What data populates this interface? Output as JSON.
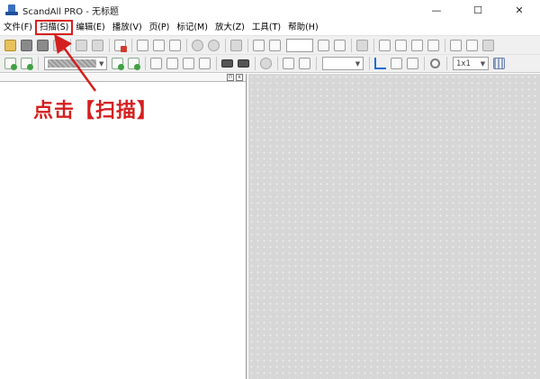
{
  "window": {
    "title": "ScandAll PRO - 无标题",
    "minimize": "—",
    "maximize": "☐",
    "close": "✕"
  },
  "menu": [
    {
      "label": "文件(F)"
    },
    {
      "label": "扫描(S)",
      "highlighted": true
    },
    {
      "label": "编辑(E)"
    },
    {
      "label": "播放(V)"
    },
    {
      "label": "页(P)"
    },
    {
      "label": "标记(M)"
    },
    {
      "label": "放大(Z)"
    },
    {
      "label": "工具(T)"
    },
    {
      "label": "帮助(H)"
    }
  ],
  "toolbar2": {
    "zoom_value": "1x1"
  },
  "left_panel": {
    "pin": "п",
    "close": "x"
  },
  "annotation": {
    "text": "点击【扫描】",
    "color": "#d41f1f"
  },
  "colors": {
    "highlight": "#d81e1e",
    "workspace": "#d7d7d7"
  }
}
